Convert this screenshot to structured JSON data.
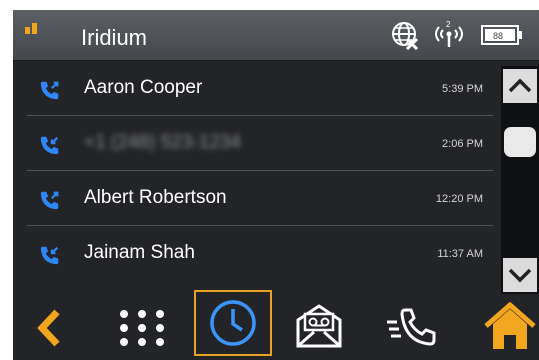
{
  "status_bar": {
    "network_name": "Iridium",
    "signal_icon": "signal-strength-icon",
    "globe_icon": "globe-icon",
    "antenna_icon": "antenna-icon",
    "battery_icon": "battery-icon",
    "antenna_label": "2",
    "battery_label": "88"
  },
  "calls": [
    {
      "name": "Aaron Cooper",
      "time": "5:39 PM",
      "direction": "outgoing",
      "redacted": false
    },
    {
      "name": "+1 (248) 523-1234",
      "time": "2:06 PM",
      "direction": "incoming",
      "redacted": true
    },
    {
      "name": "Albert Robertson",
      "time": "12:20 PM",
      "direction": "outgoing",
      "redacted": false
    },
    {
      "name": "Jainam Shah",
      "time": "11:37 AM",
      "direction": "incoming",
      "redacted": false
    }
  ],
  "scroll": {
    "up_icon": "chevron-up-icon",
    "down_icon": "chevron-down-icon"
  },
  "nav": {
    "back_icon": "back-arrow-icon",
    "keypad_icon": "keypad-icon",
    "recents_icon": "clock-icon",
    "voicemail_icon": "voicemail-icon",
    "calls_icon": "phone-icon",
    "home_icon": "home-icon",
    "selected": "recents"
  },
  "colors": {
    "accent_orange": "#f2a51e",
    "call_icon_blue": "#2f86f6",
    "nav_icon_blue": "#3a95f7",
    "background": "#232427"
  }
}
